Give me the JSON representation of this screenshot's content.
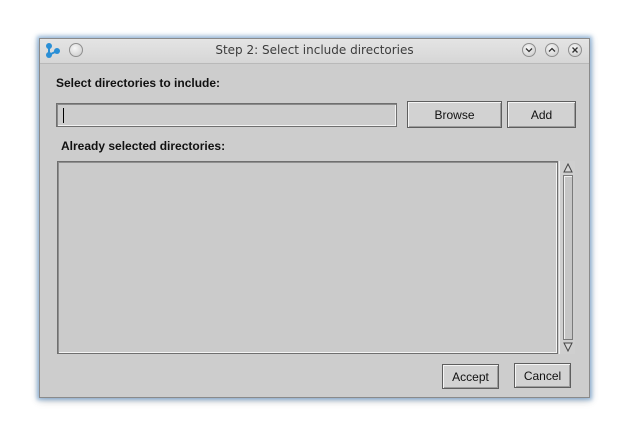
{
  "window": {
    "title": "Step 2: Select include directories",
    "app_icon": "network-nodes-icon",
    "menu_button_icon": "menu-circle-icon",
    "minimize_icon": "chevron-down-icon",
    "maximize_icon": "chevron-up-icon",
    "close_icon": "close-icon"
  },
  "form": {
    "select_label": "Select directories to include:",
    "directory_input_value": "",
    "browse_label": "Browse",
    "add_label": "Add",
    "already_label": "Already selected directories:",
    "selected_directories": []
  },
  "footer": {
    "accept_label": "Accept",
    "cancel_label": "Cancel"
  },
  "colors": {
    "window_bg": "#cdcdcd",
    "shadow_glow": "#508cc8",
    "app_icon": "#2a8fd6"
  }
}
